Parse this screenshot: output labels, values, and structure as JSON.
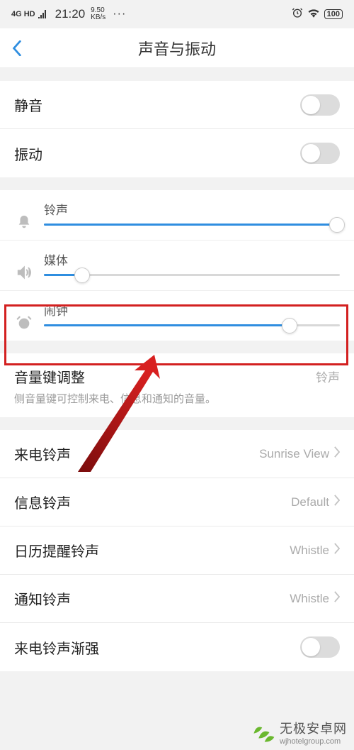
{
  "status": {
    "signal": "4G HD",
    "time": "21:20",
    "speed_val": "9.50",
    "speed_unit": "KB/s",
    "battery": "100"
  },
  "title": "声音与振动",
  "toggles": {
    "silent": "静音",
    "vibrate": "振动"
  },
  "sliders": {
    "ringtone": {
      "label": "铃声",
      "percent": 99
    },
    "media": {
      "label": "媒体",
      "percent": 13
    },
    "alarm": {
      "label": "闹钟",
      "percent": 83
    }
  },
  "volume_key": {
    "label": "音量键调整",
    "value": "铃声",
    "description": "侧音量键可控制来电、信息和通知的音量。"
  },
  "sounds": {
    "incoming": {
      "label": "来电铃声",
      "value": "Sunrise View"
    },
    "message": {
      "label": "信息铃声",
      "value": "Default"
    },
    "calendar": {
      "label": "日历提醒铃声",
      "value": "Whistle"
    },
    "notify": {
      "label": "通知铃声",
      "value": "Whistle"
    },
    "ascending": {
      "label": "来电铃声渐强"
    }
  },
  "watermark": {
    "cn": "无极安卓网",
    "en": "wjhotelgroup.com"
  }
}
